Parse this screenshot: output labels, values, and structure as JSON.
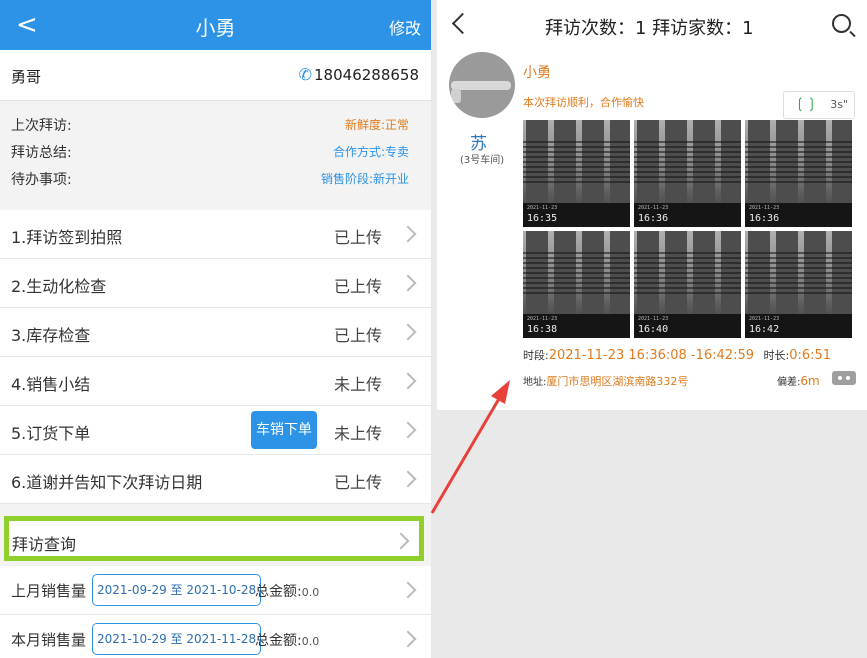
{
  "left": {
    "header": {
      "back": "<",
      "title": "小勇",
      "edit": "修改"
    },
    "contact": {
      "name": "勇哥",
      "phone": "18046288658"
    },
    "summary": [
      {
        "label": "上次拜访:",
        "value": "新鲜度:正常",
        "color": "#e07b1f"
      },
      {
        "label": "拜访总结:",
        "value": "合作方式:专卖",
        "color": "#2d93e6"
      },
      {
        "label": "待办事项:",
        "value": "销售阶段:新开业",
        "color": "#2d93e6"
      }
    ],
    "steps": [
      {
        "label": "1.拜访签到拍照",
        "status": "已上传"
      },
      {
        "label": "2.生动化检查",
        "status": "已上传"
      },
      {
        "label": "3.库存检查",
        "status": "已上传"
      },
      {
        "label": "4.销售小结",
        "status": "未上传"
      },
      {
        "label": "5.订货下单",
        "status": "未上传",
        "button": "车销下单"
      },
      {
        "label": "6.道谢并告知下次拜访日期",
        "status": "已上传"
      }
    ],
    "visit_query": "拜访查询",
    "last_month": {
      "label": "上月销售量",
      "range": "2021-09-29 至 2021-10-28",
      "total_label": "总金额:",
      "total": "0.0"
    },
    "this_month": {
      "label": "本月销售量",
      "range": "2021-10-29 至 2021-11-28",
      "total_label": "总金额:",
      "total": "0.0"
    }
  },
  "right": {
    "header": {
      "counts": "拜访次数：1 拜访家数：1"
    },
    "store_name": "苏",
    "store_sub": "(3号车间)",
    "person": "小勇",
    "note": "本次拜访顺利，合作愉快",
    "audio_duration": "3s\"",
    "photos": [
      {
        "date": "2021-11-23",
        "time": "16:35"
      },
      {
        "date": "2021-11-23",
        "time": "16:36"
      },
      {
        "date": "2021-11-23",
        "time": "16:36"
      },
      {
        "date": "2021-11-23",
        "time": "16:38"
      },
      {
        "date": "2021-11-23",
        "time": "16:40"
      },
      {
        "date": "2021-11-23",
        "time": "16:42"
      }
    ],
    "period_label": "时段:",
    "period_value": "2021-11-23 16:36:08 -16:42:59",
    "duration_label": "时长:",
    "duration_value": "0:6:51",
    "address_label": "地址:",
    "address_value": "厦门市思明区湖滨南路332号",
    "deviation_label": "偏差:",
    "deviation_value": "6m"
  },
  "colors": {
    "primary": "#2d93e6",
    "accent": "#e07b1f",
    "highlight": "#8fd12a",
    "arrow": "#e8403a"
  }
}
